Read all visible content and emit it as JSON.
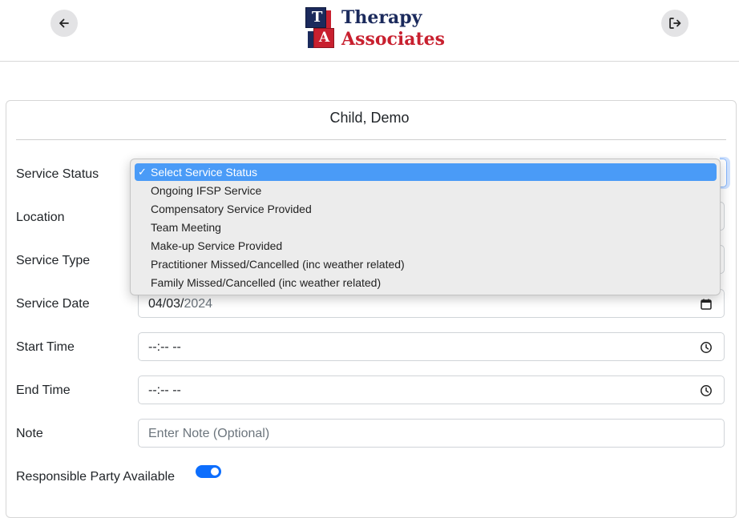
{
  "header": {
    "back_icon": "arrow-left-icon",
    "logout_icon": "logout-icon",
    "logo": {
      "line1": "Therapy",
      "line2": "Associates",
      "block_top": "T",
      "block_bottom": "A",
      "color_navy": "#1b2a5c",
      "color_red": "#c8202f"
    }
  },
  "form": {
    "title": "Child, Demo",
    "fields": {
      "service_status": {
        "label": "Service Status"
      },
      "location": {
        "label": "Location"
      },
      "service_type": {
        "label": "Service Type"
      },
      "service_date": {
        "label": "Service Date",
        "value_month_day": "04/03/",
        "value_year": "2024",
        "icon": "calendar-icon"
      },
      "start_time": {
        "label": "Start Time",
        "value": "--:-- --",
        "icon": "clock-icon"
      },
      "end_time": {
        "label": "End Time",
        "value": "--:-- --",
        "icon": "clock-icon"
      },
      "note": {
        "label": "Note",
        "placeholder": "Enter Note (Optional)"
      },
      "responsible_party": {
        "label": "Responsible Party Available",
        "checked": true
      }
    }
  },
  "dropdown": {
    "check_mark": "✓",
    "options": [
      "Select Service Status",
      "Ongoing IFSP Service",
      "Compensatory Service Provided",
      "Team Meeting",
      "Make-up Service Provided",
      "Practitioner Missed/Cancelled (inc weather related)",
      "Family Missed/Cancelled (inc weather related)"
    ],
    "selected_index": 0
  },
  "colors": {
    "accent": "#0d6efd",
    "highlight": "#4a9bf7"
  }
}
